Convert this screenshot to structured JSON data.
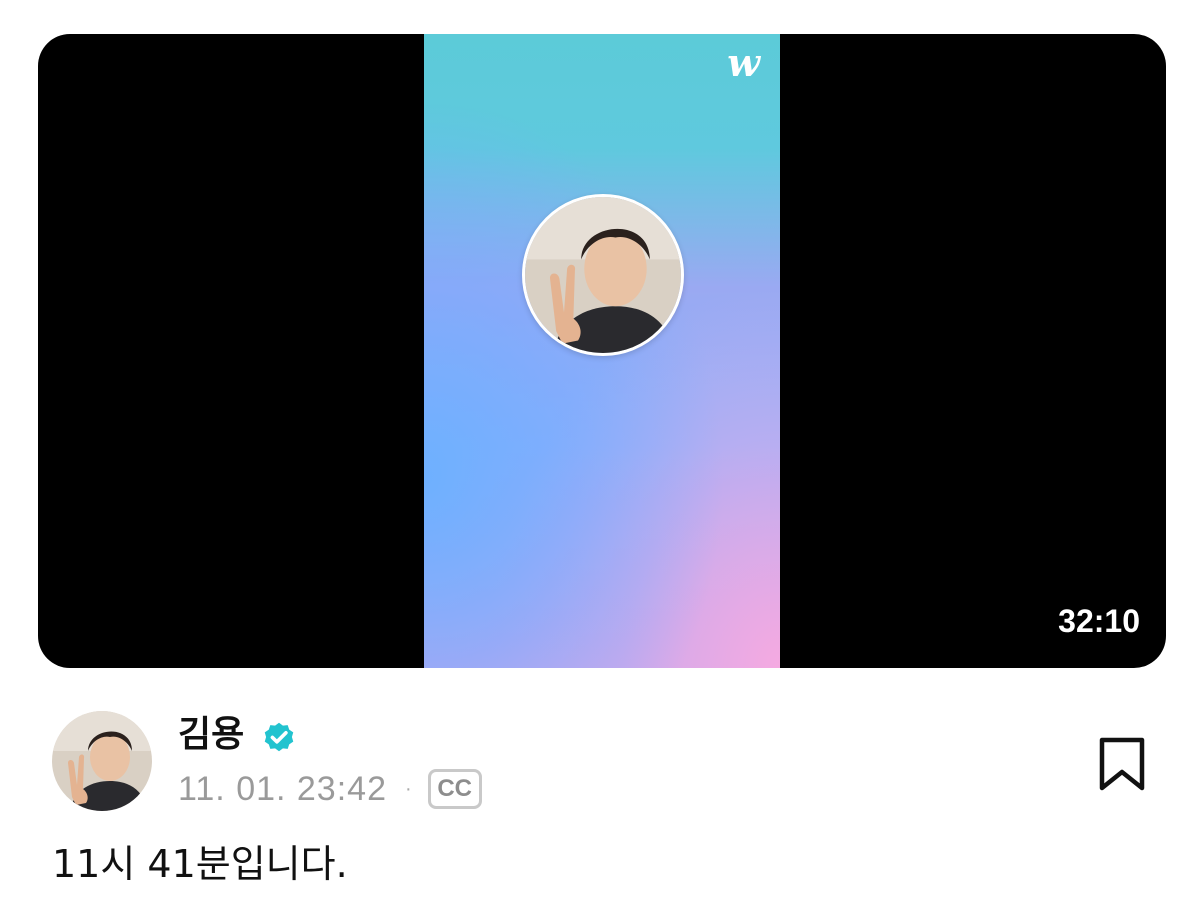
{
  "video": {
    "brand_logo": "w",
    "duration": "32:10",
    "colors": {
      "gradient_top": "#5ccbd8",
      "gradient_blue": "#6cb0ff",
      "gradient_pink": "#f5aae1",
      "letterbox": "#000000"
    }
  },
  "post": {
    "author_name": "김용",
    "verified_icon": "verified-badge-icon",
    "verified_color": "#22c3cf",
    "date": "11. 01. 23:42",
    "separator": "·",
    "cc_label": "CC",
    "bookmark_icon": "bookmark-icon",
    "body": "11시 41분입니다."
  }
}
